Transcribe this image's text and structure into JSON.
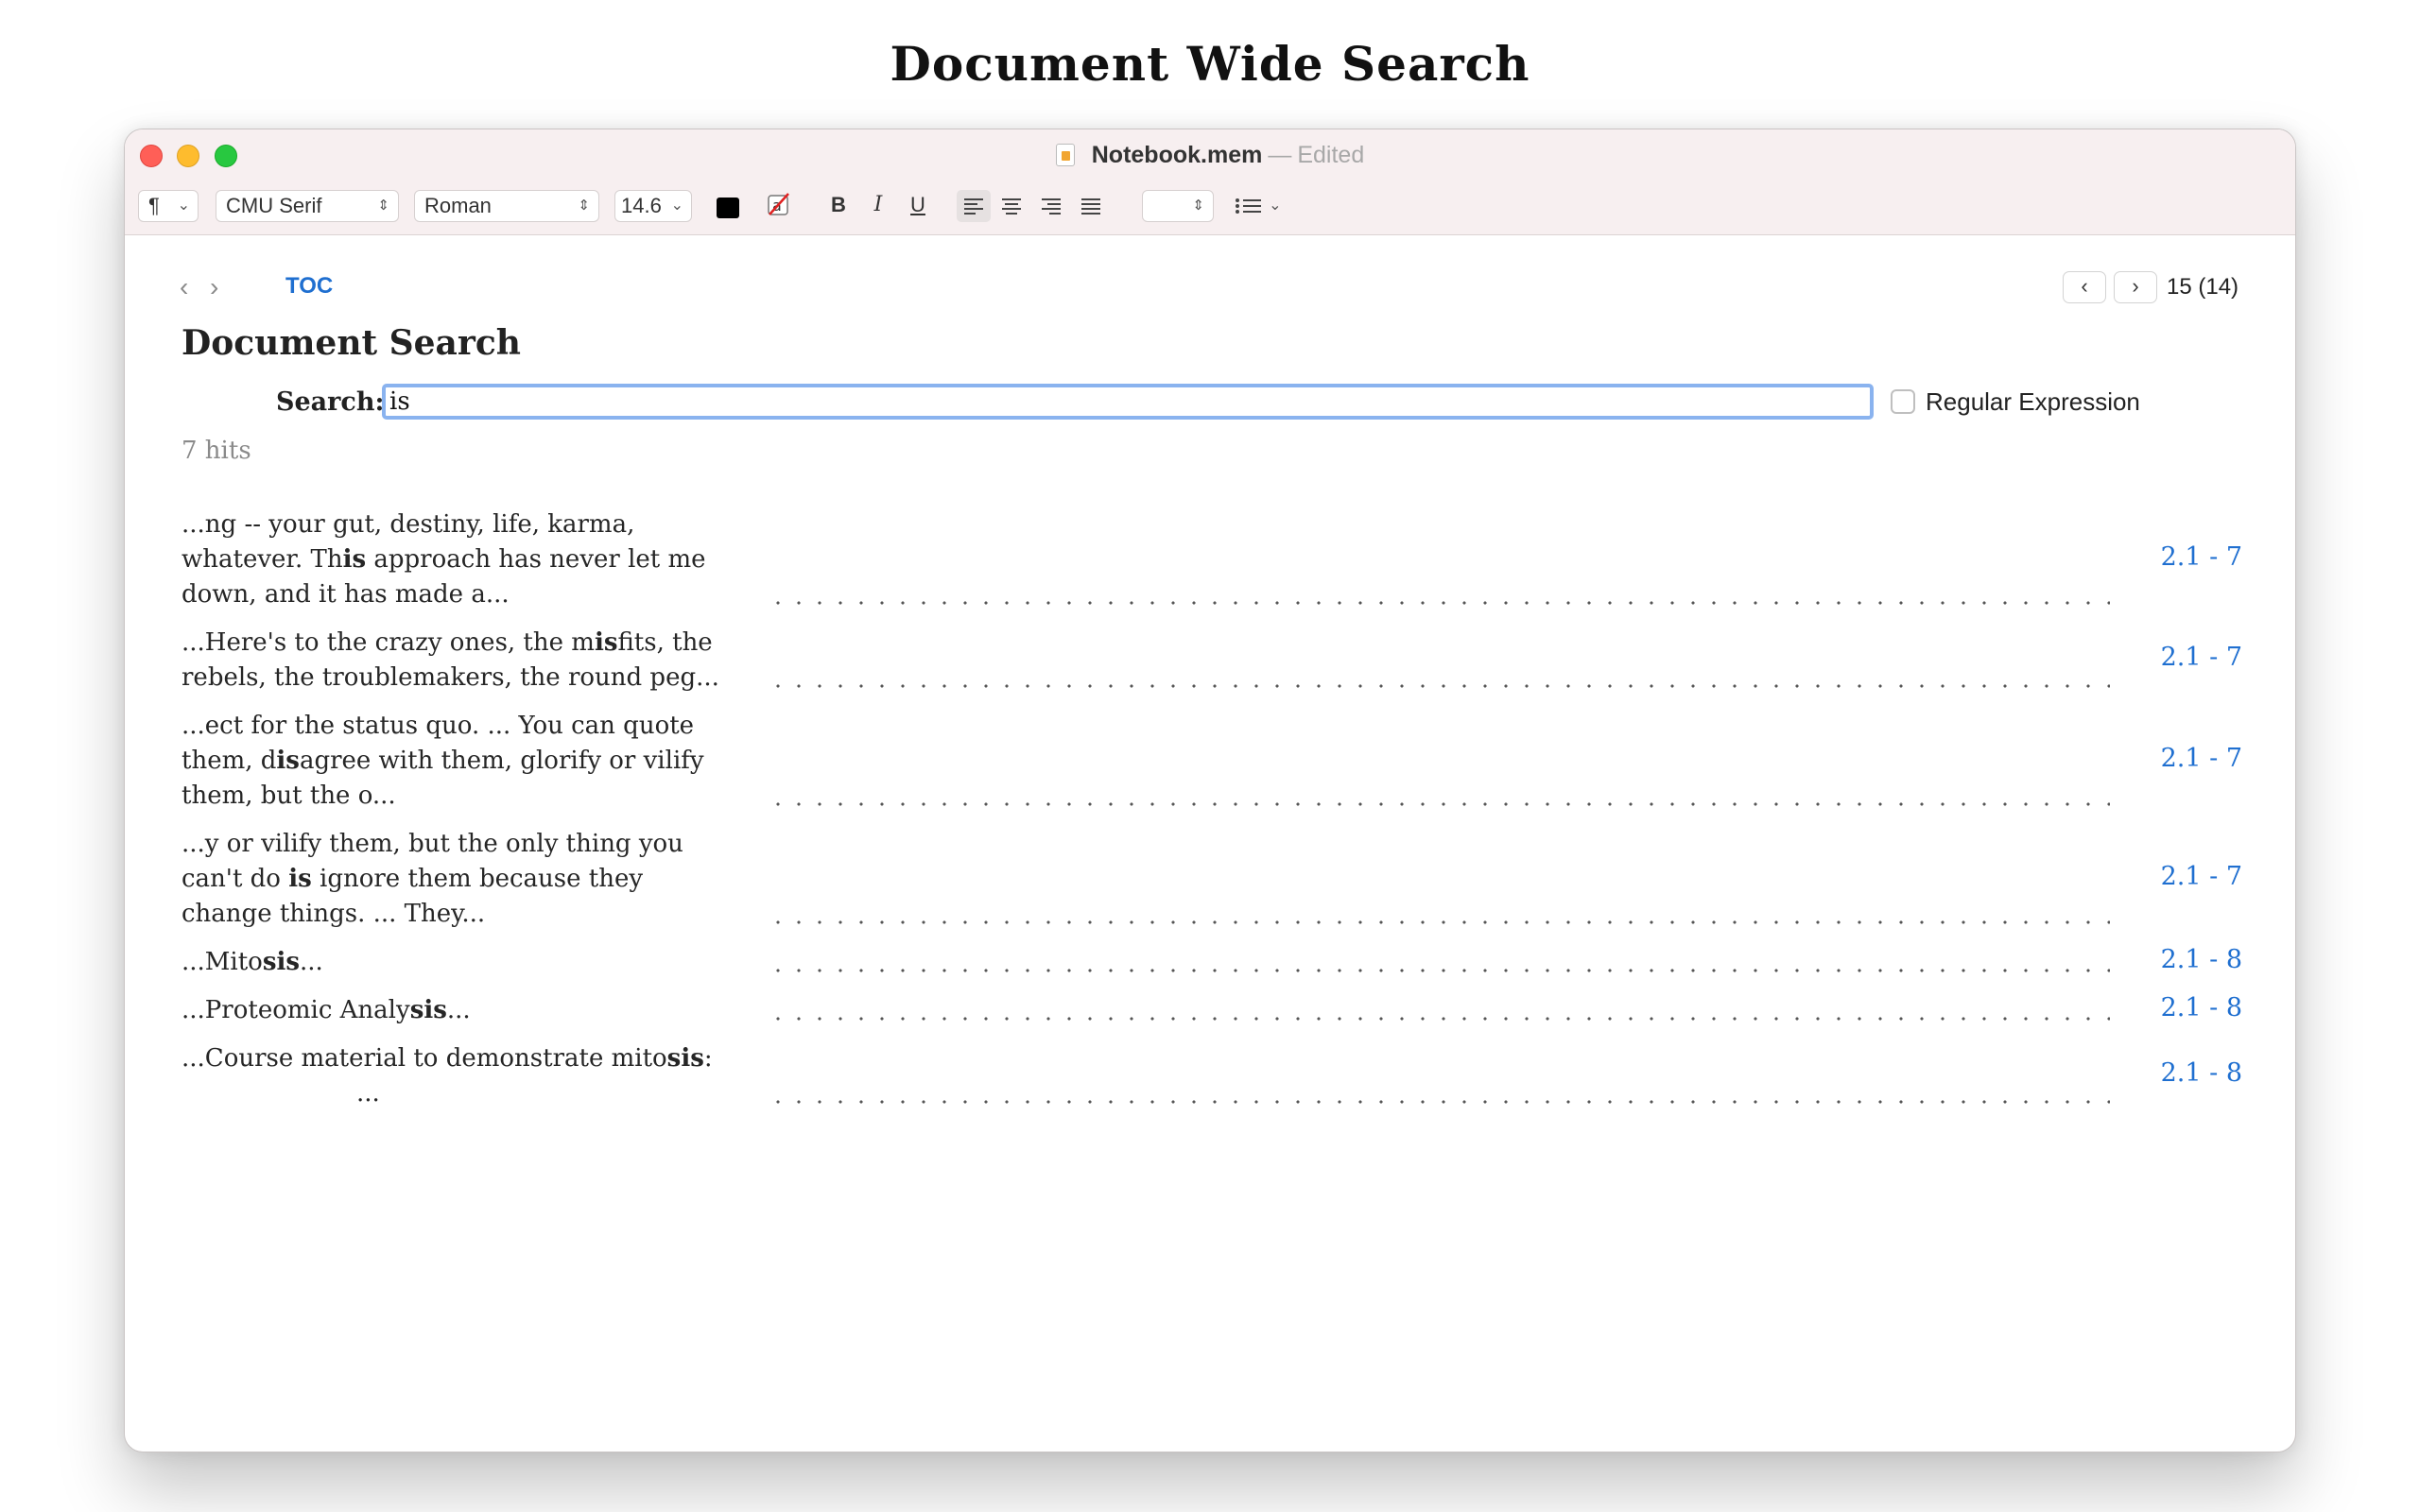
{
  "heading": "Document Wide Search",
  "window": {
    "title_name": "Notebook.mem",
    "title_separator": "—",
    "title_state": "Edited"
  },
  "toolbar": {
    "paragraph_icon": "¶",
    "font_family": "CMU Serif",
    "font_style": "Roman",
    "font_size": "14.6",
    "bold": "B",
    "italic": "I",
    "underline": "U",
    "active_alignment": "left"
  },
  "nav": {
    "toc": "TOC",
    "page_count": "15 (14)"
  },
  "doc": {
    "title": "Document Search",
    "search_label": "Search:",
    "search_value": "is",
    "regex_label": "Regular Expression",
    "hits": "7 hits"
  },
  "results": [
    {
      "before": "...ng -- your gut, destiny, life, karma, whatever. Th",
      "match": "is",
      "after": " approach has never let me down, and it has made a...",
      "ref": "2.1 - 7"
    },
    {
      "before": "...Here's to the crazy ones, the m",
      "match": "is",
      "after": "fits, the rebels, the troublemakers, the round peg...",
      "ref": "2.1 - 7"
    },
    {
      "before": "...ect for the status quo.  ... You can quote them, d",
      "match": "is",
      "after": "agree with them, glorify or vilify them, but the o...",
      "ref": "2.1 - 7"
    },
    {
      "before": "...y or vilify them, but the only thing you can't do ",
      "match": "is",
      "after": " ignore them because they change things.  ... They...",
      "ref": "2.1 - 7"
    },
    {
      "before": "...Mito",
      "match": "s",
      "mid": "i",
      "match2": "s",
      "after": "...",
      "ref": "2.1 - 8"
    },
    {
      "before": "...Proteomic Analy",
      "match": "s",
      "mid": "i",
      "match2": "s",
      "after": "...",
      "ref": "2.1 - 8"
    },
    {
      "before": "...Course material to demonstrate mito",
      "match": "s",
      "mid": "i",
      "match2": "s",
      "after": ":",
      "continuation": "...",
      "ref": "2.1 - 8"
    }
  ]
}
